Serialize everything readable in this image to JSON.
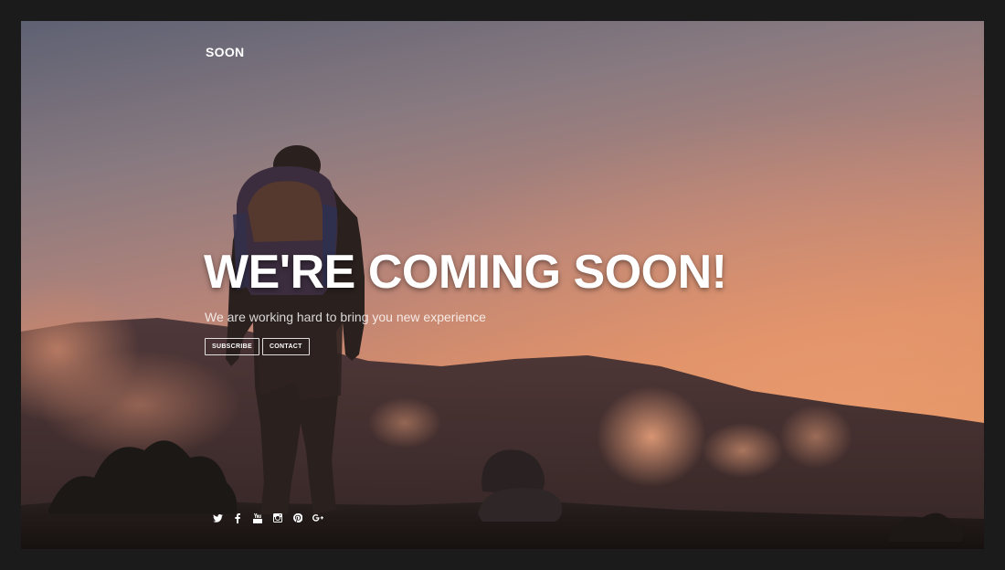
{
  "brand": {
    "name": "SOON"
  },
  "hero": {
    "headline": "WE'RE COMING SOON!",
    "subtitle": "We are working hard to bring you new experience"
  },
  "buttons": {
    "subscribe": "SUBSCRIBE",
    "contact": "CONTACT"
  },
  "social": [
    {
      "icon": "twitter-icon"
    },
    {
      "icon": "facebook-icon"
    },
    {
      "icon": "youtube-icon"
    },
    {
      "icon": "instagram-icon"
    },
    {
      "icon": "pinterest-icon"
    },
    {
      "icon": "google-plus-icon"
    }
  ],
  "colors": {
    "page_background": "#1b1b1b",
    "text": "#ffffff",
    "sky_top": "#6e6a78",
    "sky_bottom": "#e08a62"
  }
}
